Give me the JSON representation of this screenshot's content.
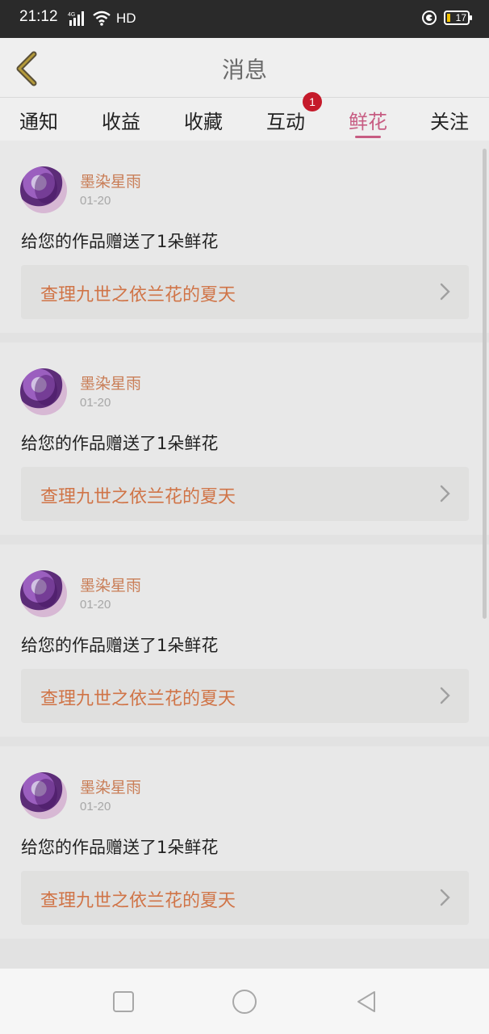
{
  "status_bar": {
    "time": "21:12",
    "network": "4G",
    "hd": "HD",
    "battery": "17",
    "icons": [
      "signal-icon",
      "wifi-icon",
      "sync-icon",
      "battery-icon"
    ]
  },
  "header": {
    "title": "消息",
    "back_icon": "chevron-left-icon"
  },
  "tabs": [
    {
      "label": "通知",
      "active": false
    },
    {
      "label": "收益",
      "active": false
    },
    {
      "label": "收藏",
      "active": false
    },
    {
      "label": "互动",
      "active": false,
      "badge": "1"
    },
    {
      "label": "鲜花",
      "active": true
    },
    {
      "label": "关注",
      "active": false
    }
  ],
  "feed": [
    {
      "user": "墨染星雨",
      "date": "01-20",
      "message": "给您的作品赠送了1朵鲜花",
      "work": "查理九世之依兰花的夏天"
    },
    {
      "user": "墨染星雨",
      "date": "01-20",
      "message": "给您的作品赠送了1朵鲜花",
      "work": "查理九世之依兰花的夏天"
    },
    {
      "user": "墨染星雨",
      "date": "01-20",
      "message": "给您的作品赠送了1朵鲜花",
      "work": "查理九世之依兰花的夏天"
    },
    {
      "user": "墨染星雨",
      "date": "01-20",
      "message": "给您的作品赠送了1朵鲜花",
      "work": "查理九世之依兰花的夏天"
    }
  ],
  "nav_bar": {
    "icons": [
      "recent-apps-icon",
      "home-icon",
      "back-icon"
    ]
  },
  "colors": {
    "accent": "#c75c82",
    "username": "#c97d56",
    "work_link": "#d07447",
    "badge": "#c51a2a"
  }
}
